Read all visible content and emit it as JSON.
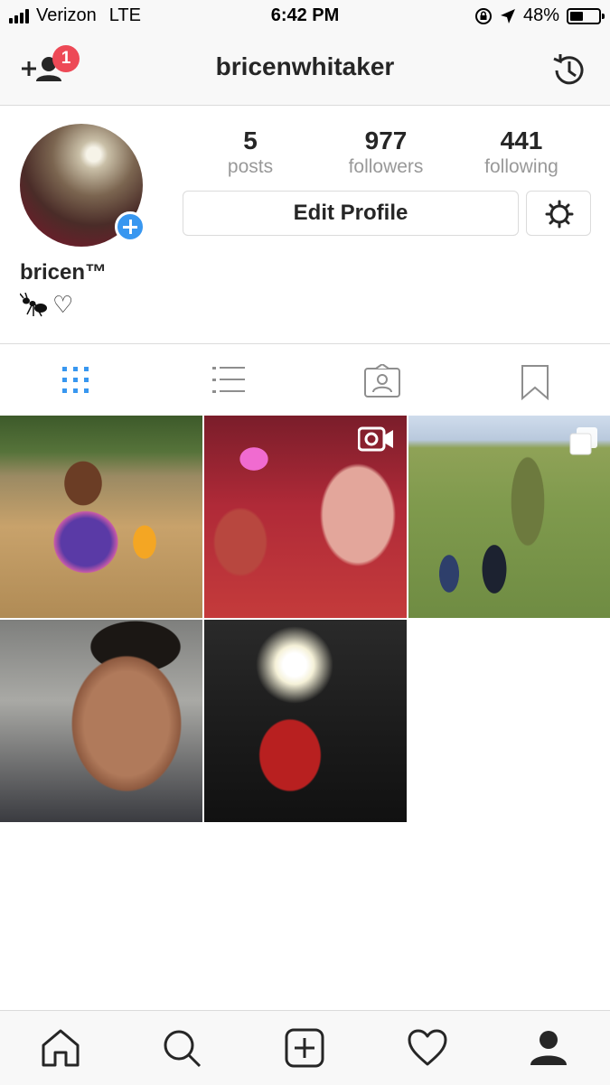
{
  "status_bar": {
    "carrier": "Verizon",
    "network": "LTE",
    "time": "6:42 PM",
    "battery_percent": "48%",
    "battery_level": 0.48,
    "icons": [
      "signal-icon",
      "orientation-lock-icon",
      "location-icon",
      "battery-icon"
    ]
  },
  "header": {
    "username": "bricenwhitaker",
    "notification_count": "1",
    "left_icon": "add-people-icon",
    "right_icon": "archive-history-icon"
  },
  "profile": {
    "display_name": "bricen™",
    "bio_text": "♡",
    "bio_icon": "ant-emoji",
    "stats": [
      {
        "value": "5",
        "label": "posts"
      },
      {
        "value": "977",
        "label": "followers"
      },
      {
        "value": "441",
        "label": "following"
      }
    ],
    "edit_button_label": "Edit Profile",
    "settings_icon": "gear-icon"
  },
  "tabs": [
    {
      "name": "grid-view",
      "icon": "grid-icon",
      "active": true
    },
    {
      "name": "list-view",
      "icon": "list-icon",
      "active": false
    },
    {
      "name": "tagged",
      "icon": "tagged-icon",
      "active": false
    },
    {
      "name": "saved",
      "icon": "bookmark-icon",
      "active": false
    }
  ],
  "posts": [
    {
      "description": "photo",
      "badge": null
    },
    {
      "description": "video",
      "badge": "video-icon"
    },
    {
      "description": "photo",
      "badge": "carousel-icon"
    },
    {
      "description": "photo",
      "badge": null
    },
    {
      "description": "photo",
      "badge": null
    }
  ],
  "bottom_nav": [
    {
      "icon": "home-icon",
      "active": false
    },
    {
      "icon": "search-icon",
      "active": false
    },
    {
      "icon": "new-post-icon",
      "active": false
    },
    {
      "icon": "activity-heart-icon",
      "active": false
    },
    {
      "icon": "profile-icon",
      "active": true
    }
  ],
  "colors": {
    "accent_blue": "#3897f0",
    "badge_red": "#ed4956",
    "text_dark": "#262626",
    "text_gray": "#999999",
    "border": "#dbdbdb"
  }
}
